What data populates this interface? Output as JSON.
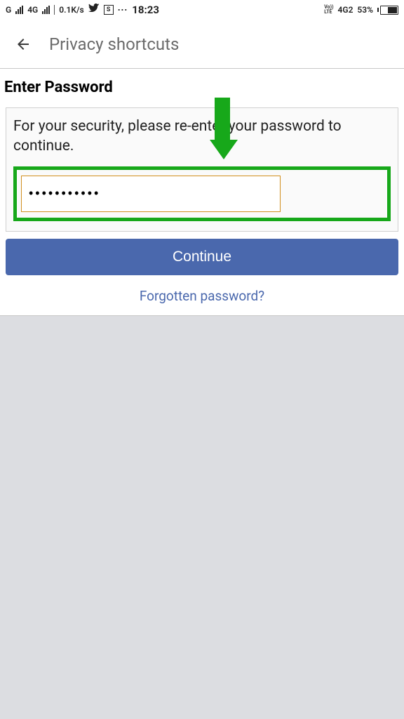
{
  "status": {
    "network1": "G",
    "network2": "4G",
    "speed": "0.1K/s",
    "boxed": "S",
    "dots": "···",
    "time": "18:23",
    "volte_top": "Vo))",
    "volte_bottom": "LTE",
    "signal2": "4G2",
    "battery_pct": "53%"
  },
  "nav": {
    "title": "Privacy shortcuts"
  },
  "form": {
    "section_title": "Enter Password",
    "instruction": "For your security, please re-enter your password to continue.",
    "password_value": "•••••••••••",
    "continue_label": "Continue",
    "forgot_label": "Forgotten password?"
  }
}
